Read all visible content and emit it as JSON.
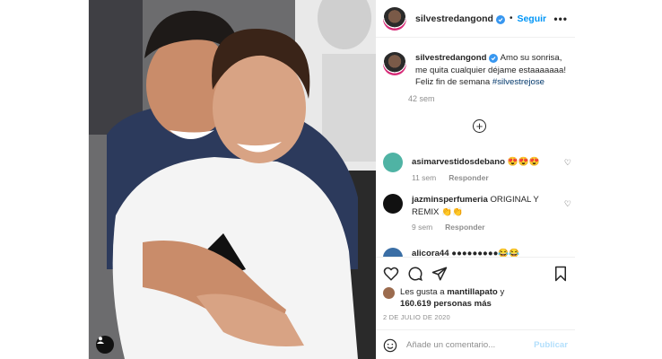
{
  "header": {
    "username": "silvestredangond",
    "separator": "•",
    "follow_label": "Seguir",
    "more": "•••"
  },
  "caption": {
    "username": "silvestredangond",
    "text": "Amo su sonrisa, me quita cualquier déjame estaaaaaaa! Feliz fin de semana",
    "hashtag": "#silvestrejose",
    "time": "42 sem"
  },
  "comments": [
    {
      "username": "asimarvestidosdebano",
      "text": "😍😍😍",
      "time": "11 sem",
      "reply_label": "Responder",
      "avatar_color": "#4fb3a4"
    },
    {
      "username": "jazminsperfumeria",
      "text": "ORIGINAL Y REMIX 👏👏",
      "time": "9 sem",
      "reply_label": "Responder",
      "avatar_color": "#111111"
    },
    {
      "username": "alicora44",
      "text": "●●●●●●●●●😂😂",
      "avatar_color": "#3a6ea5"
    }
  ],
  "likes": {
    "prefix": "Les gusta a",
    "user": "mantillapato",
    "connector": "y",
    "count": "160.619 personas más"
  },
  "date": "2 DE JULIO DE 2020",
  "add_comment": {
    "placeholder": "Añade un comentario...",
    "publish_label": "Publicar"
  },
  "colors": {
    "accent": "#0095f6",
    "publish_disabled": "#b2dffc",
    "verified": "#3897f0",
    "muted_text": "#8e8e8e"
  }
}
